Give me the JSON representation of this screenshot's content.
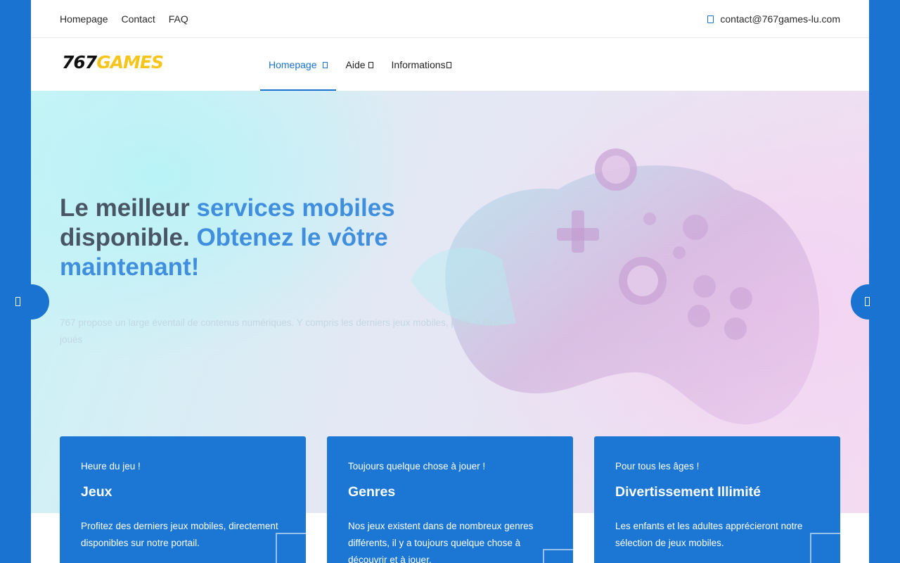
{
  "topbar": {
    "links": [
      "Homepage",
      "Contact",
      "FAQ"
    ],
    "email": "contact@767games-lu.com",
    "email_icon": "mail-icon"
  },
  "logo": {
    "number": "767",
    "word": "GAMES"
  },
  "nav": {
    "items": [
      {
        "label": "Homepage",
        "active": true
      },
      {
        "label": "Aide",
        "active": false
      },
      {
        "label": "Informations",
        "active": false
      }
    ]
  },
  "hero": {
    "title_1": "Le meilleur ",
    "title_hl_1": "services mobiles",
    "title_2": " disponible. ",
    "title_hl_2": "Obtenez le vôtre maintenant!",
    "subtitle": "767 propose un large éventail de contenus numériques. Y compris les derniers jeux mobiles, prêts à être joués"
  },
  "cards": [
    {
      "kicker": "Heure du jeu !",
      "title": "Jeux",
      "desc": "Profitez des derniers jeux mobiles, directement disponibles sur notre portail."
    },
    {
      "kicker": "Toujours quelque chose à jouer !",
      "title": "Genres",
      "desc": "Nos jeux existent dans de nombreux genres différents, il y a toujours quelque chose à découvrir et à jouer."
    },
    {
      "kicker": "Pour tous les âges !",
      "title": "Divertissement Illimité",
      "desc": "Les enfants et les adultes apprécieront notre sélection de jeux mobiles."
    }
  ],
  "colors": {
    "brand_blue": "#1a73d1",
    "logo_yellow": "#f5c51b",
    "highlight": "#3f8fde"
  }
}
